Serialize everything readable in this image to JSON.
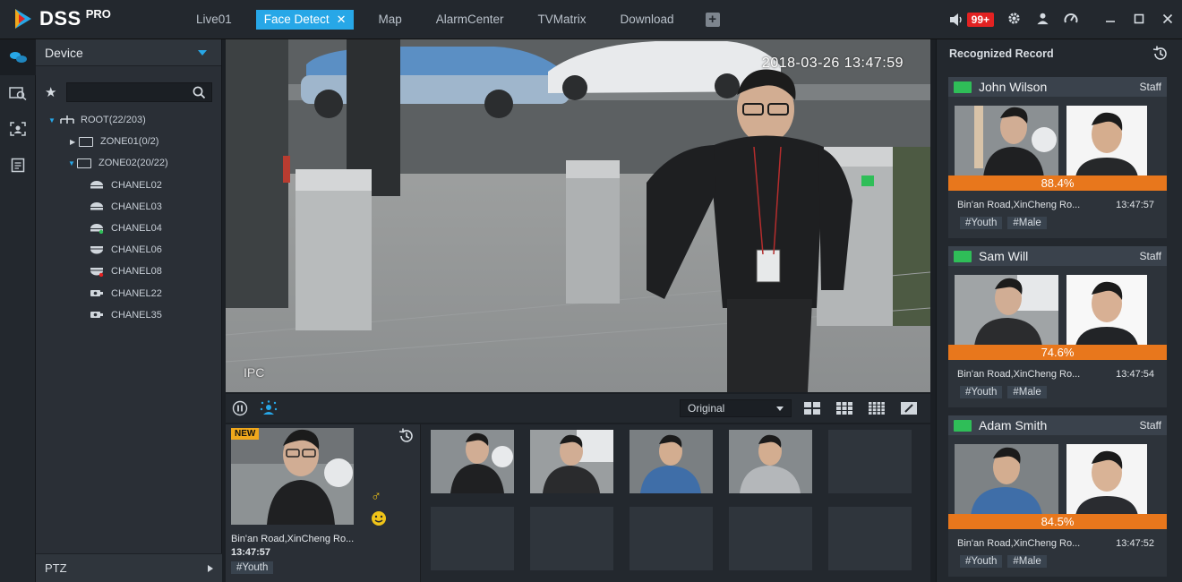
{
  "app": {
    "name": "DSS",
    "edition": "PRO"
  },
  "nav": {
    "tabs": [
      {
        "label": "Live01"
      },
      {
        "label": "Face Detect",
        "active": true
      },
      {
        "label": "Map"
      },
      {
        "label": "AlarmCenter"
      },
      {
        "label": "TVMatrix"
      },
      {
        "label": "Download"
      }
    ],
    "add_icon": "plus-icon"
  },
  "top_right": {
    "alarm_count": "99+",
    "icons": [
      "speaker-icon",
      "gear-icon",
      "user-icon",
      "gauge-icon",
      "minimize-icon",
      "maximize-icon",
      "close-icon"
    ]
  },
  "colors": {
    "accent": "#27a7e7",
    "alarm": "#e32222",
    "score": "#e8771c",
    "new_badge": "#f0a81c",
    "staff_id": "#2fbe58"
  },
  "device_panel": {
    "title": "Device",
    "search_placeholder": "",
    "tree": {
      "root": "ROOT(22/203)",
      "zones": [
        {
          "label": "ZONE01(0/2)",
          "expanded": false
        },
        {
          "label": "ZONE02(20/22)",
          "expanded": true
        }
      ],
      "channels": [
        {
          "label": "CHANEL02",
          "icon": "dome-camera-icon"
        },
        {
          "label": "CHANEL03",
          "icon": "dome-camera-icon"
        },
        {
          "label": "CHANEL04",
          "icon": "dome-camera-online-icon"
        },
        {
          "label": "CHANEL06",
          "icon": "dome-camera-icon"
        },
        {
          "label": "CHANEL08",
          "icon": "dome-camera-alarm-icon"
        },
        {
          "label": "CHANEL22",
          "icon": "bullet-camera-icon"
        },
        {
          "label": "CHANEL35",
          "icon": "bullet-camera-icon"
        }
      ]
    },
    "ptz_label": "PTZ"
  },
  "video": {
    "timestamp": "2018-03-26 13:47:59",
    "watermark": "IPC"
  },
  "video_toolbar": {
    "stream": "Original"
  },
  "latest_capture": {
    "badge": "NEW",
    "gender_symbol": "♂",
    "location": "Bin'an Road,XinCheng Ro...",
    "time": "13:47:57",
    "tag": "#Youth"
  },
  "record": {
    "title": "Recognized Record",
    "items": [
      {
        "name": "John Wilson",
        "role": "Staff",
        "score": "88.4%",
        "location": "Bin'an Road,XinCheng Ro...",
        "time": "13:47:57",
        "tags": [
          "#Youth",
          "#Male"
        ]
      },
      {
        "name": "Sam Will",
        "role": "Staff",
        "score": "74.6%",
        "location": "Bin'an Road,XinCheng Ro...",
        "time": "13:47:54",
        "tags": [
          "#Youth",
          "#Male"
        ]
      },
      {
        "name": "Adam Smith",
        "role": "Staff",
        "score": "84.5%",
        "location": "Bin'an Road,XinCheng Ro...",
        "time": "13:47:52",
        "tags": [
          "#Youth",
          "#Male"
        ]
      }
    ]
  }
}
